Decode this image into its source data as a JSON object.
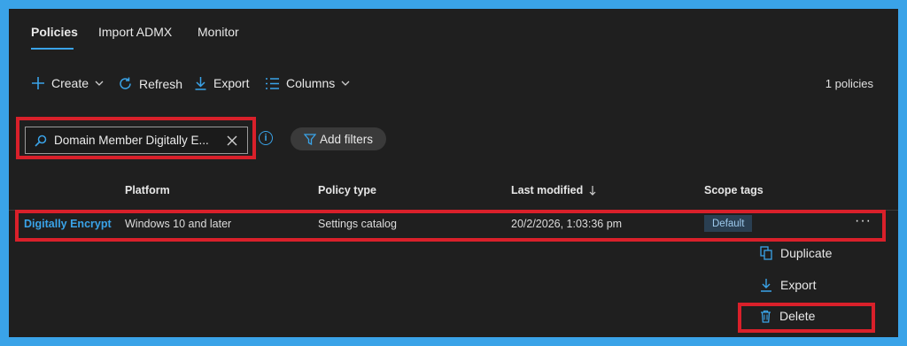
{
  "tabs": [
    {
      "label": "Policies",
      "active": true
    },
    {
      "label": "Import ADMX",
      "active": false
    },
    {
      "label": "Monitor",
      "active": false
    }
  ],
  "toolbar": {
    "create": "Create",
    "refresh": "Refresh",
    "export": "Export",
    "columns": "Columns",
    "count": "1 policies"
  },
  "search": {
    "value": "Domain Member Digitally E..."
  },
  "filters": {
    "add_label": "Add filters"
  },
  "table": {
    "headers": {
      "platform": "Platform",
      "policy_type": "Policy type",
      "last_modified": "Last modified",
      "scope_tags": "Scope tags"
    },
    "row": {
      "name": "Digitally Encrypt C",
      "platform": "Windows 10 and later",
      "policy_type": "Settings catalog",
      "last_modified": "20/2/2026, 1:03:36 pm",
      "scope_tag": "Default"
    }
  },
  "context_menu": {
    "duplicate": "Duplicate",
    "export": "Export",
    "delete": "Delete"
  },
  "colors": {
    "accent": "#3aa3e8",
    "highlight": "#d9202a",
    "background": "#1f1f1f"
  }
}
